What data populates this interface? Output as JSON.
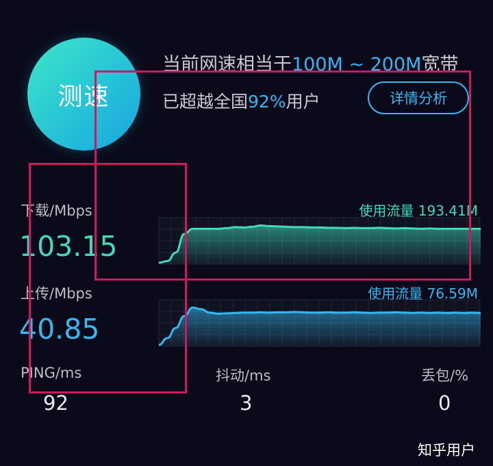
{
  "test_button": {
    "label": "测速"
  },
  "summary": {
    "speed_prefix": "当前网速相当于",
    "speed_range": "100M ~ 200M",
    "speed_suffix": "宽带",
    "beat_prefix": "已超越全国",
    "beat_percent": "92%",
    "beat_suffix": "用户"
  },
  "detail_button": {
    "label": "详情分析"
  },
  "download": {
    "label": "下载/Mbps",
    "value": "103.15",
    "traffic": "使用流量 193.41M",
    "color": "#3fdcbc"
  },
  "upload": {
    "label": "上传/Mbps",
    "value": "40.85",
    "traffic": "使用流量 76.59M",
    "color": "#35b8f0"
  },
  "stats": {
    "ping_label": "PING/ms",
    "ping_value": "92",
    "jitter_label": "抖动/ms",
    "jitter_value": "3",
    "loss_label": "丢包/%",
    "loss_value": "0"
  },
  "watermark": "知乎用户",
  "chart_data": [
    {
      "type": "area",
      "series": [
        {
          "values": [
            0,
            0.05,
            0.3,
            0.85,
            1.0,
            1.0,
            1.0,
            1.0,
            1.02,
            1.05,
            1.04,
            1.06,
            1.1,
            1.08,
            1.07,
            1.06,
            1.05,
            1.05,
            1.04,
            1.04,
            1.03,
            1.03,
            1.02,
            1.03,
            1.02,
            1.02,
            1.03,
            1.02,
            1.01,
            1.02,
            1.01,
            1.0,
            1.01,
            1.0,
            1.0,
            1.0,
            1.0,
            1.0,
            1.0
          ]
        }
      ],
      "color": "#3fdcbc"
    },
    {
      "type": "area",
      "series": [
        {
          "values": [
            0,
            0.2,
            0.5,
            0.85,
            1.1,
            1.05,
            0.95,
            0.92,
            0.93,
            0.94,
            0.95,
            0.95,
            0.96,
            0.95,
            0.96,
            0.96,
            0.97,
            0.96,
            0.95,
            0.95,
            0.96,
            0.95,
            0.95,
            0.96,
            0.95,
            0.94,
            0.95,
            0.95,
            0.96,
            0.95,
            0.94,
            0.95,
            0.94,
            0.95,
            0.94,
            0.95,
            0.94,
            0.95,
            0.94
          ]
        }
      ],
      "color": "#35b8f0"
    }
  ]
}
